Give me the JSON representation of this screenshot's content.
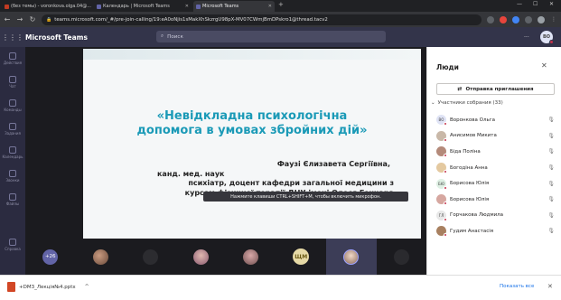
{
  "browser": {
    "tabs": [
      {
        "label": "(без темы) - voronkova.olga.04@..."
      },
      {
        "label": "Календарь | Microsoft Teams"
      },
      {
        "label": "Microsoft Teams"
      }
    ],
    "new_tab": "+",
    "address": "teams.microsoft.com/_#/pre-join-calling/19:eA0oNjis1sMakXhSkzrgU98pX-MV07CWmjBmDPskro1@thread.tacv2",
    "accent": "#1a73e8"
  },
  "teams": {
    "app_title": "Microsoft Teams",
    "search_placeholder": "Поиск",
    "more": "...",
    "user_initials": "ВО",
    "header_bg": "#33344a",
    "brand": "#6264a7"
  },
  "rail": [
    {
      "label": "Действия",
      "icon": "bell-icon"
    },
    {
      "label": "Чат",
      "icon": "chat-icon"
    },
    {
      "label": "Команды",
      "icon": "teams-icon"
    },
    {
      "label": "Задания",
      "icon": "assignments-icon"
    },
    {
      "label": "Календарь",
      "icon": "calendar-icon"
    },
    {
      "label": "Звонки",
      "icon": "phone-icon"
    },
    {
      "label": "Файлы",
      "icon": "files-icon"
    },
    {
      "label": "Справка",
      "icon": "help-icon"
    }
  ],
  "slide": {
    "title_line1": "«Невідкладна психологічна",
    "title_line2": "допомога в умовах збройних дій»",
    "author_lines": [
      "Фаузі Єлизавета Сергіївна,",
      "канд. мед. наук",
      "психіатр, доцент кафедри загальної медицини з",
      "курсом фізичної терапії ДНУ імені Олеся Гончара"
    ],
    "title_color": "#1b9ab7"
  },
  "tooltip": "Нажмите клавиши CTRL+SHIFT+M, чтобы включить микрофон.",
  "strip": {
    "more_count": "+26",
    "initials": "ЩМ"
  },
  "panel": {
    "title": "Люди",
    "invite_label": "Отправка приглашения",
    "section_label": "Участники собрания (33)",
    "participants": [
      {
        "initials": "ВО",
        "name": "Воронкова Ольга",
        "color": "#dfe3f5"
      },
      {
        "initials": "",
        "name": "Анисимов Микита",
        "color": "#c9b8a8"
      },
      {
        "initials": "",
        "name": "Біда Поліна",
        "color": "#b48a7a"
      },
      {
        "initials": "",
        "name": "Богодіна Анна",
        "color": "#e4c9a0"
      },
      {
        "initials": "БЮ",
        "name": "Борисова Юлія",
        "color": "#dff0e4"
      },
      {
        "initials": "",
        "name": "Борисова Юлія",
        "color": "#d6a7a0"
      },
      {
        "initials": "ГЛ",
        "name": "Горчакова Людмила",
        "color": "#e8e8e8"
      },
      {
        "initials": "",
        "name": "Гудим Анастасія",
        "color": "#a88060"
      }
    ]
  },
  "downloads": {
    "file": "+DM3_Лекція№4.pptx",
    "show_all": "Показать все",
    "close": "✕"
  }
}
